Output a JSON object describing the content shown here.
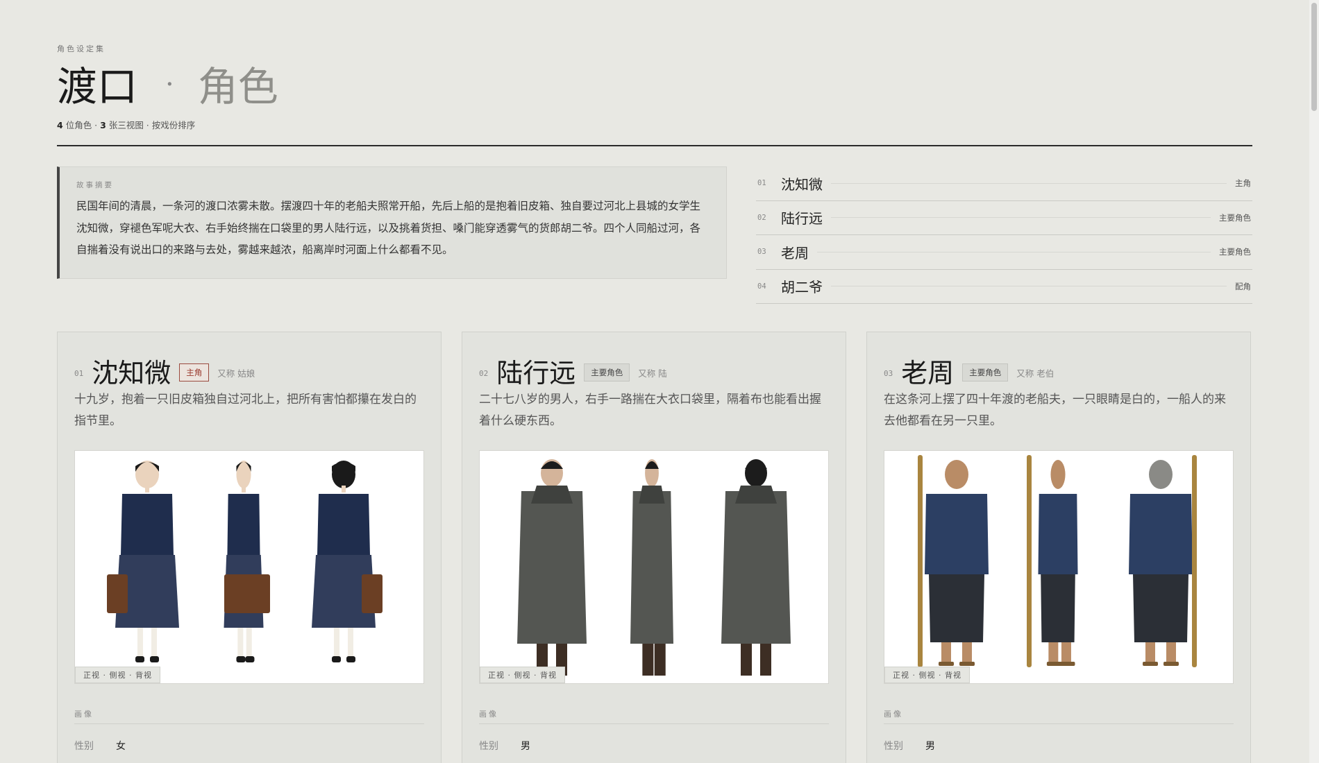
{
  "header": {
    "kicker": "角色设定集",
    "title_main": "渡口",
    "title_sep": "·",
    "title_sub": "角色",
    "meta": {
      "count_chars": "4",
      "unit_chars": "位角色 ·",
      "count_sheets": "3",
      "unit_sheets": "张三视图 · 按戏份排序"
    }
  },
  "synopsis": {
    "label": "故事摘要",
    "text": "民国年间的清晨，一条河的渡口浓雾未散。摆渡四十年的老船夫照常开船，先后上船的是抱着旧皮箱、独自要过河北上县城的女学生沈知微，穿褪色军呢大衣、右手始终揣在口袋里的男人陆行远，以及挑着货担、嗓门能穿透雾气的货郎胡二爷。四个人同船过河，各自揣着没有说出口的来路与去处，雾越来越浓，船离岸时河面上什么都看不见。"
  },
  "roster": [
    {
      "num": "01",
      "name": "沈知微",
      "role": "主角"
    },
    {
      "num": "02",
      "name": "陆行远",
      "role": "主要角色"
    },
    {
      "num": "03",
      "name": "老周",
      "role": "主要角色"
    },
    {
      "num": "04",
      "name": "胡二爷",
      "role": "配角"
    }
  ],
  "cards": [
    {
      "num": "01",
      "name": "沈知微",
      "tag": "主角",
      "alias": "又称 姑娘",
      "desc": "十九岁，抱着一只旧皮箱独自过河北上，把所有害怕都攥在发白的指节里。",
      "views_label": "正视 · 侧视 · 背视",
      "section": "画像",
      "attr_key": "性别",
      "attr_val": "女",
      "colors": {
        "cloth": "#1f2d4d",
        "skin": "#ead3bd",
        "prop": "#6b3f24"
      }
    },
    {
      "num": "02",
      "name": "陆行远",
      "tag": "主要角色",
      "alias": "又称 陆",
      "desc": "二十七八岁的男人，右手一路揣在大衣口袋里，隔着布也能看出握着什么硬东西。",
      "views_label": "正视 · 侧视 · 背视",
      "section": "画像",
      "attr_key": "性别",
      "attr_val": "男",
      "colors": {
        "cloth": "#545652",
        "skin": "#d4b49a",
        "prop": "#3d2e24"
      }
    },
    {
      "num": "03",
      "name": "老周",
      "tag": "主要角色",
      "alias": "又称 老伯",
      "desc": "在这条河上摆了四十年渡的老船夫，一只眼睛是白的，一船人的来去他都看在另一只里。",
      "views_label": "正视 · 侧视 · 背视",
      "section": "画像",
      "attr_key": "性别",
      "attr_val": "男",
      "colors": {
        "cloth": "#2c3f63",
        "skin": "#b98c66",
        "prop": "#a9853f"
      }
    }
  ]
}
